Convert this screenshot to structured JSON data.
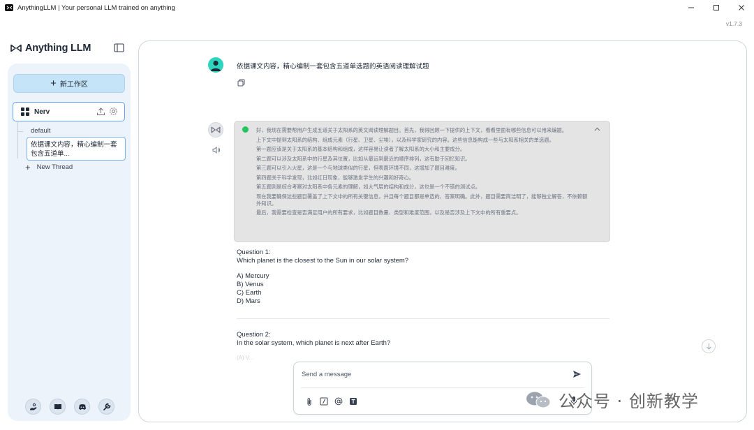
{
  "window": {
    "title": "AnythingLLM | Your personal LLM trained on anything",
    "version": "v1.7.3",
    "controls": {
      "minimize": "—",
      "maximize": "☐",
      "close": "✕"
    }
  },
  "sidebar": {
    "brand": "Anything LLM",
    "new_workspace_label": "新工作区",
    "workspace": {
      "name": "Nerv"
    },
    "threads": [
      {
        "label": "default"
      },
      {
        "label": "依据课文内容，精心编制一套包含五道单..."
      }
    ],
    "new_thread_label": "New Thread",
    "bottom_icons": [
      "community-hub-icon",
      "docs-book-icon",
      "discord-icon",
      "settings-wrench-icon"
    ]
  },
  "chat": {
    "user_message": "依据课文内容，精心编制一套包含五道单选题的英语阅读理解试题",
    "thought": {
      "paragraphs": [
        "好，我现在需要帮用户生成五道关于太阳系的英文阅读理解题目。首先，我得回顾一下提供的上下文，看看里面有哪些信息可以用来编题。",
        "上下文中提到太阳系的结构、组成元素（行星、卫星、尘埃），以及科学家研究的内容。这些信息能构成一些与太阳系相关的单选题。",
        "第一题应该是关于太阳系的基本结构和组成，这样容易让读者了解太阳系的大小和主要成分。",
        "第二题可以涉及太阳系中的行星及其位置，比如从最远到最近的顺序排列，这有助于回忆知识。",
        "第三题可以引入火星，这是一个与地球类似的行星，但表面环境不同，这增加了题目难度。",
        "第四题关于科学发现，比如红日现象，能够激发学生的兴趣和好奇心。",
        "第五题则是综合考察对太阳系中各元素的理解，如大气层的结构和成分，这也是一个不错的测试点。",
        "现在我要确保这些题目覆盖了上下文中的所有关键信息，并且每个题目都是单选的，答案明确。此外，题目需要简洁明了，能够独立解答，不依赖额外知识。",
        "最后，我需要检查是否满足用户的所有要求，比如题目数量、类型和难度范围，以及是否涉及上下文中的所有重要点。"
      ]
    },
    "questions": [
      {
        "label": "Question 1:",
        "text": "Which planet is the closest to the Sun in our solar system?",
        "options": [
          "A) Mercury",
          "B) Venus",
          "C) Earth",
          "D) Mars"
        ]
      },
      {
        "label": "Question 2:",
        "text": "In the solar system, which planet is next after Earth?"
      }
    ],
    "faded_partial": "(A) V..."
  },
  "composer": {
    "placeholder": "Send a message",
    "value": ""
  },
  "watermark": {
    "text": "公众号 · 创新教学"
  },
  "colors": {
    "accent": "#60a5fa",
    "new_workspace_bg": "#c6e4f7",
    "sidebar_bg": "#edf3fa",
    "thought_bg": "#e4e4e4",
    "user_avatar": "#2dd4bf",
    "thought_check": "#22c55e"
  }
}
